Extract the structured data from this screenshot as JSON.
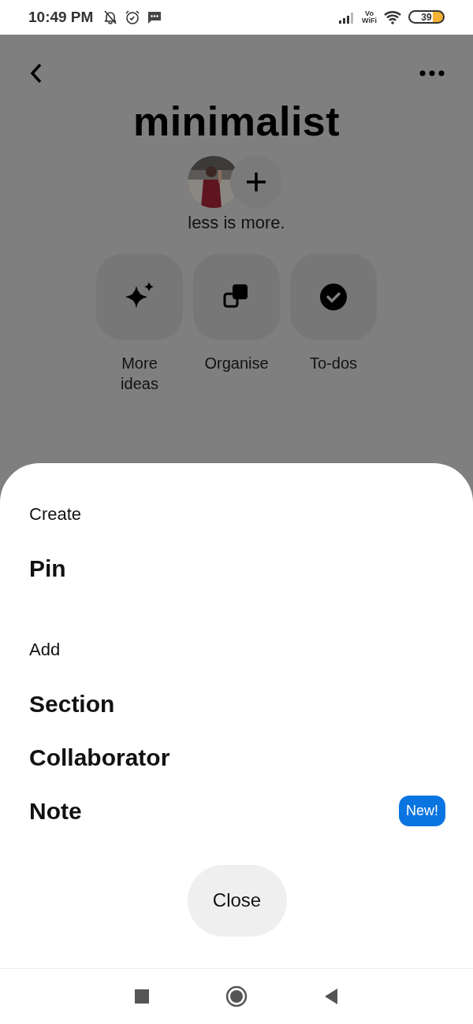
{
  "status_bar": {
    "time": "10:49 PM",
    "network_top": "Vo",
    "network_bottom": "WiFi",
    "battery": "39"
  },
  "board": {
    "title": "minimalist",
    "description": "less is more.",
    "actions": [
      {
        "kind": "sparkle",
        "label": "More ideas"
      },
      {
        "kind": "organise",
        "label": "Organise"
      },
      {
        "kind": "todo",
        "label": "To-dos"
      }
    ]
  },
  "sheet": {
    "sections": [
      {
        "heading": "Create",
        "items": [
          {
            "label": "Pin"
          }
        ]
      },
      {
        "heading": "Add",
        "items": [
          {
            "label": "Section"
          },
          {
            "label": "Collaborator"
          },
          {
            "label": "Note",
            "badge": "New!"
          }
        ]
      }
    ],
    "close_button": "Close"
  }
}
